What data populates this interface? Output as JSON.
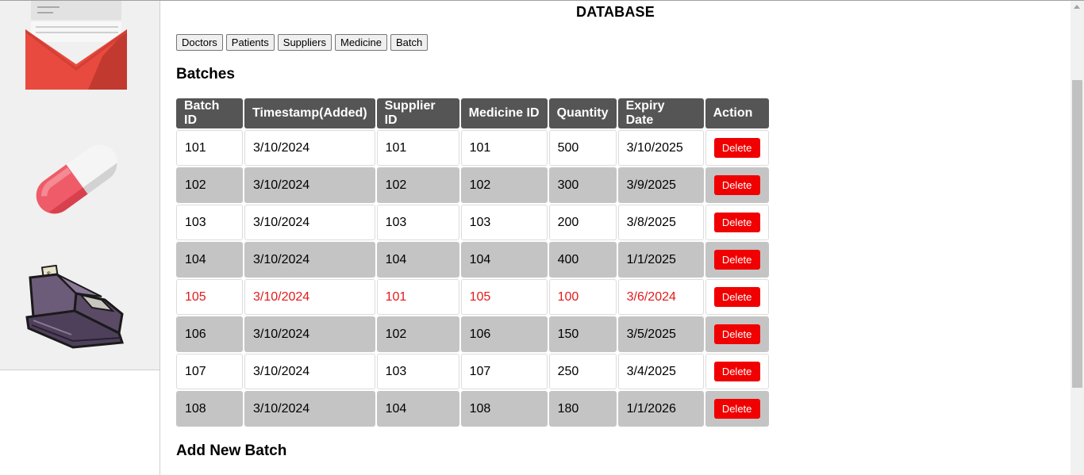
{
  "page": {
    "title": "DATABASE"
  },
  "nav": {
    "buttons": [
      "Doctors",
      "Patients",
      "Suppliers",
      "Medicine",
      "Batch"
    ]
  },
  "sidebar": {
    "icons": [
      "envelope-icon",
      "pill-icon",
      "cash-register-icon"
    ]
  },
  "section": {
    "title": "Batches"
  },
  "table": {
    "headers": [
      "Batch ID",
      "Timestamp(Added)",
      "Supplier ID",
      "Medicine ID",
      "Quantity",
      "Expiry Date",
      "Action"
    ],
    "rows": [
      {
        "batch_id": "101",
        "timestamp": "3/10/2024",
        "supplier_id": "101",
        "medicine_id": "101",
        "quantity": "500",
        "expiry": "3/10/2025",
        "action": "Delete",
        "expired": false
      },
      {
        "batch_id": "102",
        "timestamp": "3/10/2024",
        "supplier_id": "102",
        "medicine_id": "102",
        "quantity": "300",
        "expiry": "3/9/2025",
        "action": "Delete",
        "expired": false
      },
      {
        "batch_id": "103",
        "timestamp": "3/10/2024",
        "supplier_id": "103",
        "medicine_id": "103",
        "quantity": "200",
        "expiry": "3/8/2025",
        "action": "Delete",
        "expired": false
      },
      {
        "batch_id": "104",
        "timestamp": "3/10/2024",
        "supplier_id": "104",
        "medicine_id": "104",
        "quantity": "400",
        "expiry": "1/1/2025",
        "action": "Delete",
        "expired": false
      },
      {
        "batch_id": "105",
        "timestamp": "3/10/2024",
        "supplier_id": "101",
        "medicine_id": "105",
        "quantity": "100",
        "expiry": "3/6/2024",
        "action": "Delete",
        "expired": true
      },
      {
        "batch_id": "106",
        "timestamp": "3/10/2024",
        "supplier_id": "102",
        "medicine_id": "106",
        "quantity": "150",
        "expiry": "3/5/2025",
        "action": "Delete",
        "expired": false
      },
      {
        "batch_id": "107",
        "timestamp": "3/10/2024",
        "supplier_id": "103",
        "medicine_id": "107",
        "quantity": "250",
        "expiry": "3/4/2025",
        "action": "Delete",
        "expired": false
      },
      {
        "batch_id": "108",
        "timestamp": "3/10/2024",
        "supplier_id": "104",
        "medicine_id": "108",
        "quantity": "180",
        "expiry": "1/1/2026",
        "action": "Delete",
        "expired": false
      }
    ]
  },
  "add_section": {
    "title": "Add New Batch"
  },
  "colors": {
    "header_bg": "#555555",
    "even_row_bg": "#c4c4c4",
    "delete_bg": "#f00000",
    "expired_text": "#e31a1a"
  }
}
